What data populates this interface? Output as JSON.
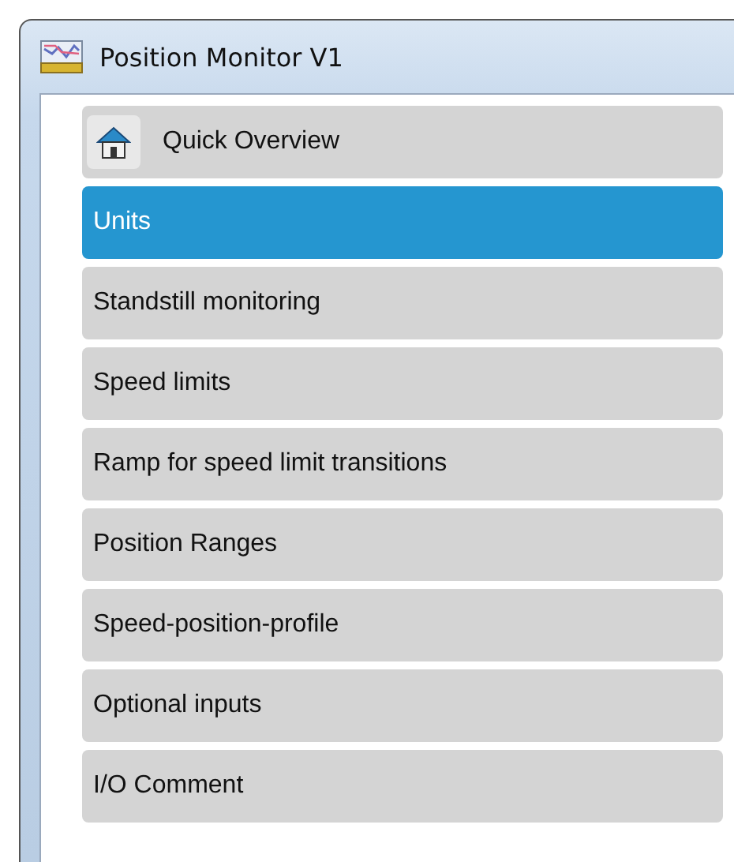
{
  "window": {
    "title": "Position Monitor V1"
  },
  "nav": [
    {
      "kind": "home",
      "label": "Quick Overview",
      "selected": false
    },
    {
      "kind": "item",
      "label": "Units",
      "selected": true
    },
    {
      "kind": "item",
      "label": "Standstill monitoring",
      "selected": false
    },
    {
      "kind": "item",
      "label": "Speed limits",
      "selected": false
    },
    {
      "kind": "item",
      "label": "Ramp for speed limit transitions",
      "selected": false
    },
    {
      "kind": "item",
      "label": "Position Ranges",
      "selected": false
    },
    {
      "kind": "item",
      "label": "Speed-position-profile",
      "selected": false
    },
    {
      "kind": "item",
      "label": "Optional inputs",
      "selected": false
    },
    {
      "kind": "item",
      "label": "I/O Comment",
      "selected": false
    }
  ]
}
